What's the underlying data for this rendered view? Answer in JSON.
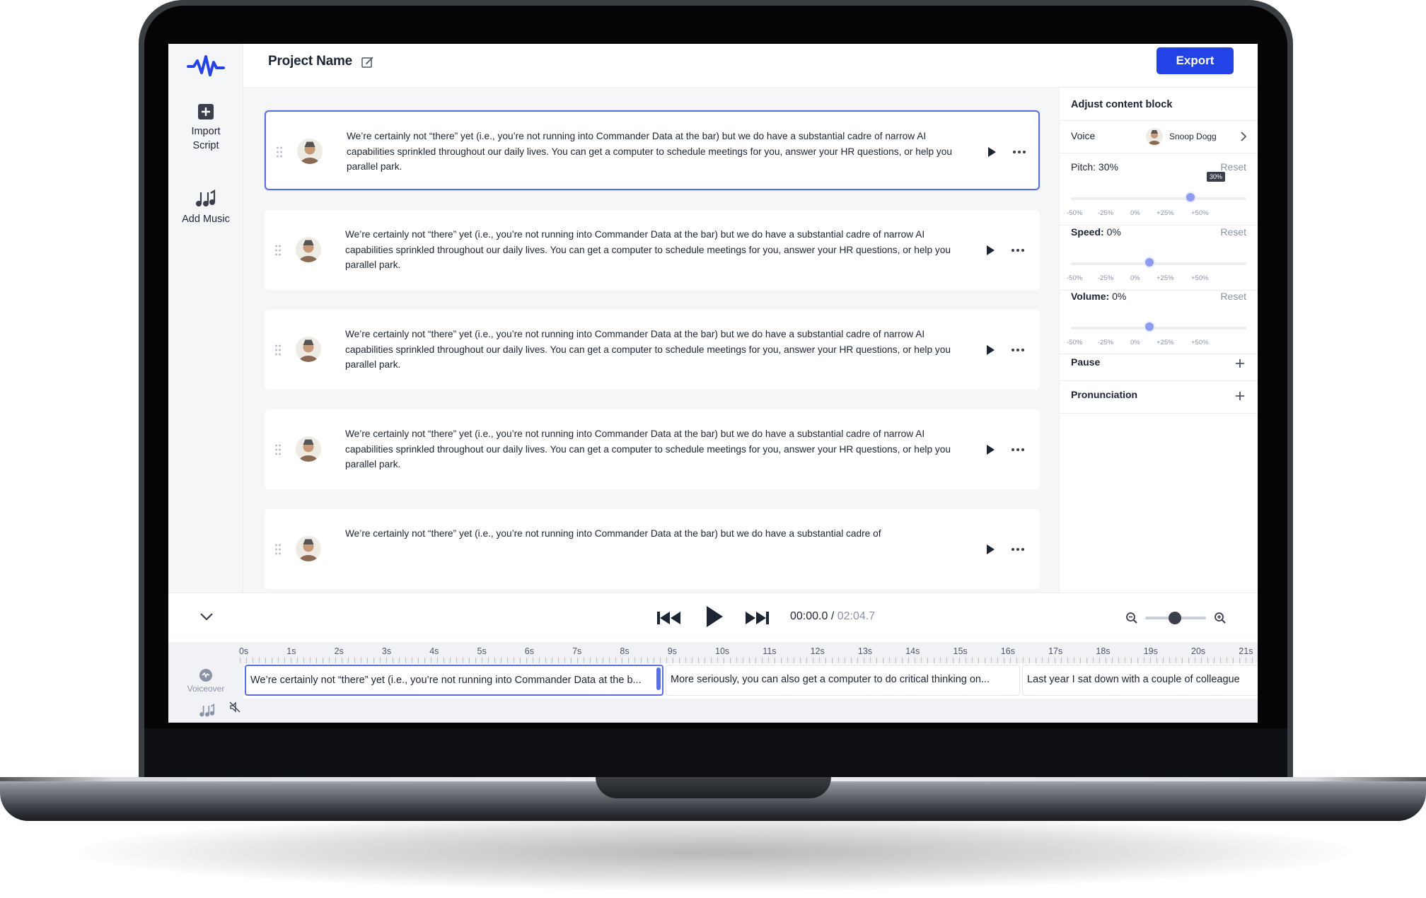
{
  "app": {
    "project_name": "Project Name",
    "export_label": "Export"
  },
  "leftnav": {
    "import_label_1": "Import",
    "import_label_2": "Script",
    "music_label": "Add Music"
  },
  "blocks": [
    {
      "text": "We’re certainly not “there” yet (i.e., you’re not running into Commander Data at the bar) but we do have a substantial cadre of narrow AI capabilities sprinkled throughout our daily lives. You can get a computer to schedule meetings for you, answer your HR questions, or help you parallel park.",
      "selected": true
    },
    {
      "text": "We’re certainly not “there” yet (i.e., you’re not running into Commander Data at the bar) but we do have a substantial cadre of narrow AI capabilities sprinkled throughout our daily lives. You can get a computer to schedule meetings for you, answer your HR questions, or help you parallel park.",
      "selected": false
    },
    {
      "text": "We’re certainly not “there” yet (i.e., you’re not running into Commander Data at the bar) but we do have a substantial cadre of narrow AI capabilities sprinkled throughout our daily lives. You can get a computer to schedule meetings for you, answer your HR questions, or help you parallel park.",
      "selected": false
    },
    {
      "text": "We’re certainly not “there” yet (i.e., you’re not running into Commander Data at the bar) but we do have a substantial cadre of narrow AI capabilities sprinkled throughout our daily lives. You can get a computer to schedule meetings for you, answer your HR questions, or help you parallel park.",
      "selected": false
    },
    {
      "text": "We’re certainly not “there” yet (i.e., you’re not running into Commander Data at the bar) but we do have a substantial cadre of",
      "selected": false
    }
  ],
  "panel": {
    "title": "Adjust content block",
    "voice_label": "Voice",
    "voice_name": "Snoop Dogg",
    "pitch_label": "Pitch:",
    "pitch_value": "30%",
    "pitch_tooltip": "30%",
    "pitch_level": 30,
    "speed_label": "Speed:",
    "speed_value": "0%",
    "speed_level": 0,
    "volume_label": "Volume:",
    "volume_value": "0%",
    "volume_level": 0,
    "reset_label": "Reset",
    "ticks": [
      "-50%",
      "-25%",
      "0%",
      "+25%",
      "+50%"
    ],
    "pause_label": "Pause",
    "pronunciation_label": "Pronunciation"
  },
  "player": {
    "current_time": "00:00.0",
    "separator": " / ",
    "total_time": "02:04.7"
  },
  "timeline": {
    "ruler": [
      "0s",
      "1s",
      "2s",
      "3s",
      "4s",
      "5s",
      "6s",
      "7s",
      "8s",
      "9s",
      "10s",
      "11s",
      "12s",
      "13s",
      "14s",
      "15s",
      "16s",
      "17s",
      "18s",
      "19s",
      "20s",
      "21s"
    ],
    "tracks": {
      "voiceover": "Voiceover",
      "music": "Music"
    },
    "clips": [
      "We’re certainly not “there” yet (i.e., you’re not running into Commander Data at the b...",
      "More seriously, you can also get a computer to do critical thinking on...",
      "Last year I sat down with a couple of colleague"
    ]
  },
  "colors": {
    "accent": "#2443e6",
    "selection": "#5b70e0",
    "slider": "#8c9cf2"
  }
}
